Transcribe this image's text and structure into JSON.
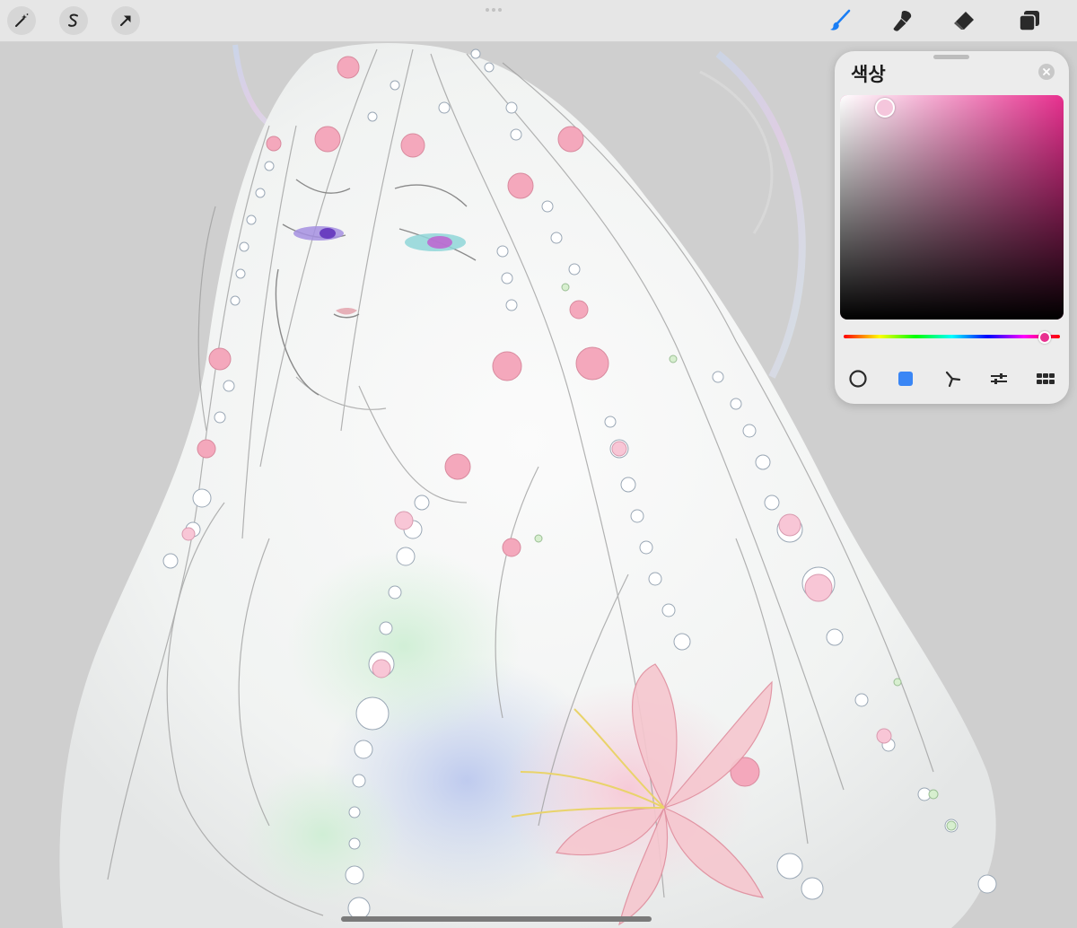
{
  "app": {
    "toolbar": {
      "left_tools": [
        {
          "icon": "adjustments-wand-icon"
        },
        {
          "icon": "selection-s-icon"
        },
        {
          "icon": "transform-arrow-icon"
        }
      ],
      "right_tools": [
        {
          "icon": "brush-icon",
          "active": true
        },
        {
          "icon": "smudge-icon"
        },
        {
          "icon": "eraser-icon"
        },
        {
          "icon": "layers-icon"
        }
      ]
    },
    "color_panel": {
      "title": "색상",
      "current_color": "#f5c6dc",
      "hue_color": "#e8308f",
      "hue_position": 0.93,
      "sv_saturation": 0.2,
      "sv_value": 0.97,
      "modes": [
        {
          "icon": "disc-mode-icon"
        },
        {
          "icon": "classic-mode-icon",
          "active": true
        },
        {
          "icon": "harmony-mode-icon"
        },
        {
          "icon": "value-mode-icon"
        },
        {
          "icon": "palettes-mode-icon"
        }
      ]
    },
    "colors": {
      "accent": "#1a7ef5",
      "toolbar_bg": "#e6e6e6",
      "canvas_bg": "#cfcfcf"
    }
  }
}
